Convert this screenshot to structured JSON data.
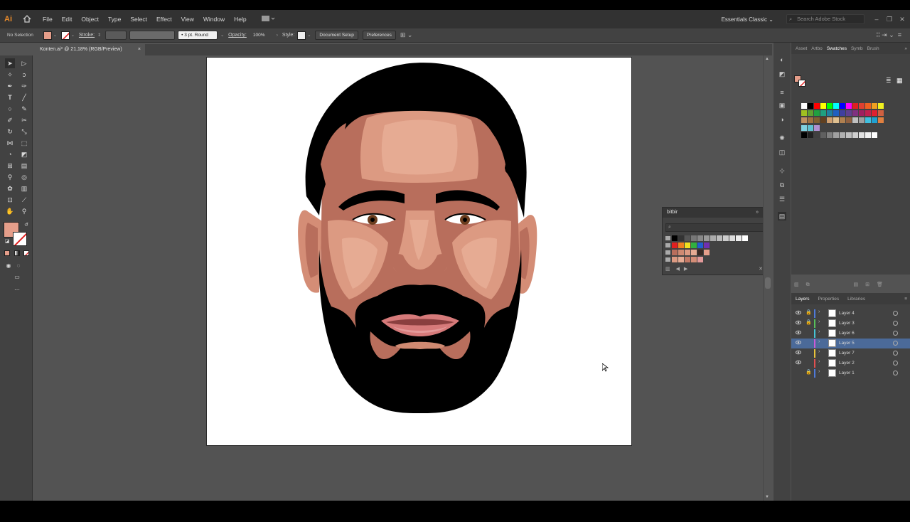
{
  "app": {
    "logo": "Ai",
    "menu": [
      "File",
      "Edit",
      "Object",
      "Type",
      "Select",
      "Effect",
      "View",
      "Window",
      "Help"
    ],
    "workspace": "Essentials Classic",
    "stock_placeholder": "Search Adobe Stock"
  },
  "control": {
    "selection": "No Selection",
    "stroke_label": "Stroke:",
    "brush": "3 pt. Round",
    "opacity_label": "Opacity:",
    "opacity_value": "100%",
    "style_label": "Style:",
    "doc_setup": "Document Setup",
    "preferences": "Preferences"
  },
  "document": {
    "tab_title": "Konten.ai* @ 21,18% (RGB/Preview)",
    "close": "×"
  },
  "colors": {
    "fill": "#e59e8a",
    "hair": "#000000",
    "skin": "#b86e5c",
    "skin_light": "#dc9a82",
    "skin_mid": "#cf8a72",
    "lips": "#d67a7a",
    "accent_selected": "#4b6a99"
  },
  "swatches_panel": {
    "tabs": [
      "Asset",
      "Artbo",
      "Swatches",
      "Symb",
      "Brush"
    ],
    "active_tab": "Swatches"
  },
  "bitbir": {
    "title": "bitbir"
  },
  "layers_panel": {
    "tabs": [
      "Layers",
      "Properties",
      "Libraries"
    ],
    "active_tab": "Layers",
    "layers": [
      {
        "name": "Layer 4",
        "color": "#4f7ad9",
        "locked": true,
        "visible": true,
        "selected": false
      },
      {
        "name": "Layer 3",
        "color": "#58c05a",
        "locked": true,
        "visible": true,
        "selected": false
      },
      {
        "name": "Layer 6",
        "color": "#46c3d6",
        "locked": false,
        "visible": true,
        "selected": false
      },
      {
        "name": "Layer 5",
        "color": "#cc5ad6",
        "locked": false,
        "visible": true,
        "selected": true
      },
      {
        "name": "Layer 7",
        "color": "#e8c23a",
        "locked": false,
        "visible": true,
        "selected": false
      },
      {
        "name": "Layer 2",
        "color": "#e05050",
        "locked": false,
        "visible": true,
        "selected": false
      },
      {
        "name": "Layer 1",
        "color": "#4f7ad9",
        "locked": true,
        "visible": false,
        "selected": false
      }
    ]
  }
}
